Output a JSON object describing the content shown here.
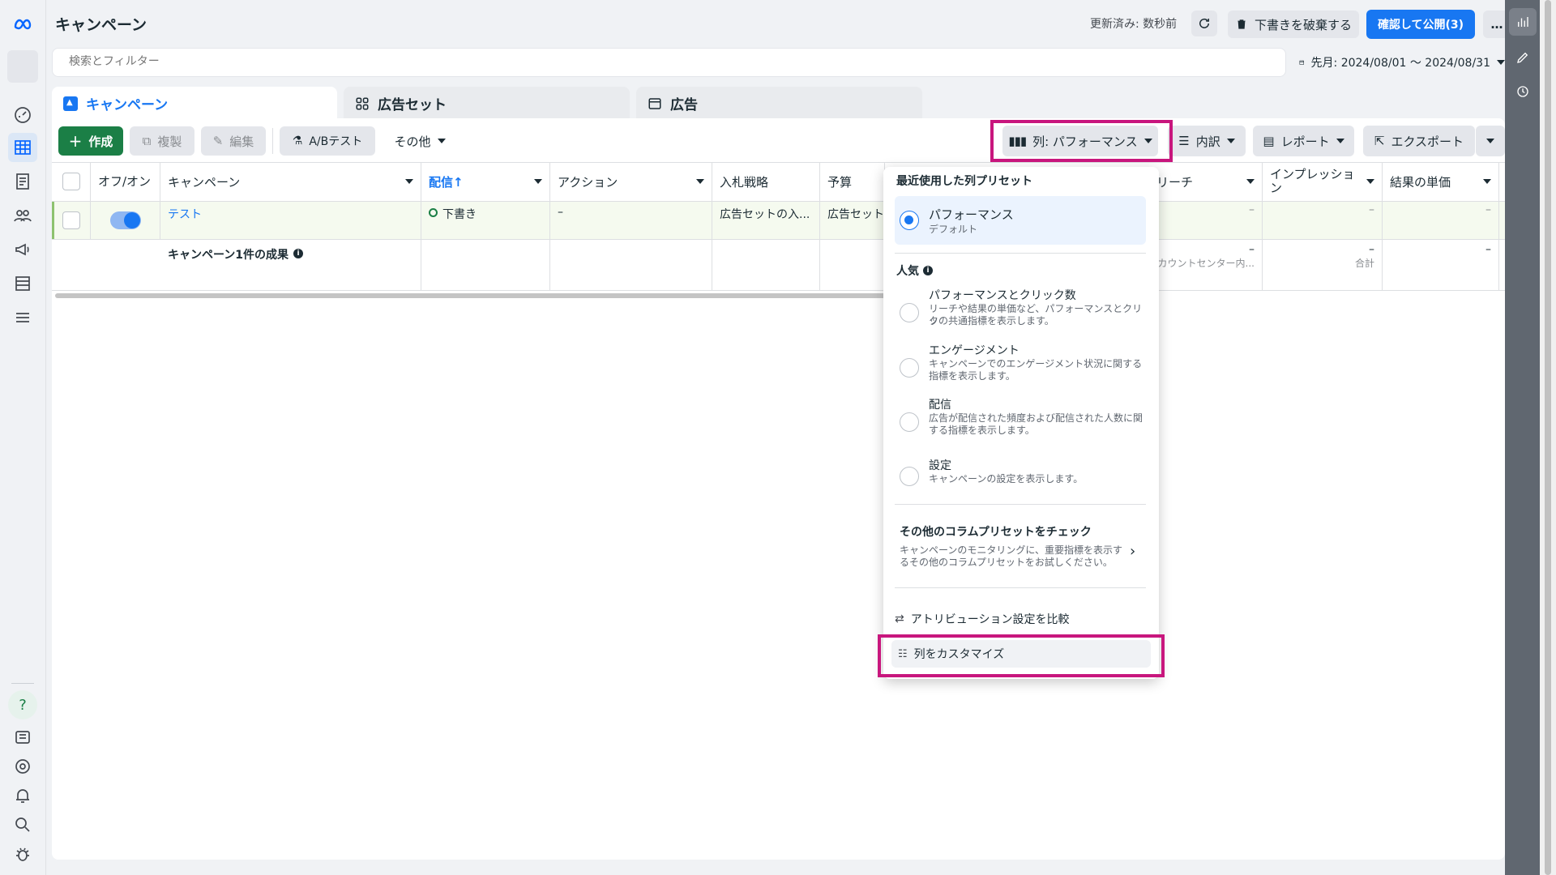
{
  "header": {
    "title": "キャンペーン",
    "updated": "更新済み: 数秒前",
    "discard_label": "下書きを破棄する",
    "publish_label": "確認して公開(3)",
    "more_label": "…"
  },
  "search": {
    "placeholder": "検索とフィルター"
  },
  "date_range": {
    "label": "先月: 2024/08/01 ～ 2024/08/31"
  },
  "tabs": [
    {
      "label": "キャンペーン",
      "active": true
    },
    {
      "label": "広告セット",
      "active": false
    },
    {
      "label": "広告",
      "active": false
    }
  ],
  "toolbar": {
    "create": "作成",
    "duplicate": "複製",
    "edit": "編集",
    "abtest": "A/Bテスト",
    "more": "その他",
    "columns": "列: パフォーマンス",
    "breakdown": "内訳",
    "reports": "レポート",
    "export": "エクスポート"
  },
  "table": {
    "columns": {
      "toggle": "オフ/オン",
      "campaign": "キャンペーン",
      "delivery": "配信↑",
      "actions": "アクション",
      "bid": "入札戦略",
      "budget": "予算",
      "reach": "リーチ",
      "impressions": "インプレッション",
      "cost_per_result": "結果の単価"
    },
    "row": {
      "name": "テスト",
      "delivery": "下書き",
      "actions": "–",
      "bid": "広告セットの入...",
      "budget": "広告セット",
      "reach": "–",
      "impressions": "–",
      "cost_per_result": "–"
    },
    "summary": {
      "label": "キャンペーン1件の成果",
      "reach": "–",
      "reach_sub": "アカウントセンター内...",
      "impressions": "–",
      "impressions_sub": "合計",
      "cost_per_result": "–"
    }
  },
  "dropdown": {
    "recent_title": "最近使用した列プリセット",
    "selected": {
      "title": "パフォーマンス",
      "sub": "デフォルト"
    },
    "popular_title": "人気",
    "options": [
      {
        "title": "パフォーマンスとクリック数",
        "desc1": "リーチや結果の単価など、パフォーマンスとクリッ",
        "desc2": "クの共通指標を表示します。"
      },
      {
        "title": "エンゲージメント",
        "desc1": "キャンペーンでのエンゲージメント状況に関する",
        "desc2": "指標を表示します。"
      },
      {
        "title": "配信",
        "desc1": "広告が配信された頻度および配信された人数に関",
        "desc2": "する指標を表示します。"
      },
      {
        "title": "設定",
        "desc1": "キャンペーンの設定を表示します。",
        "desc2": ""
      }
    ],
    "more_title": "その他のコラムプリセットをチェック",
    "more_desc1": "キャンペーンのモニタリングに、重要指標を表示す",
    "more_desc2": "るその他のコラムプリセットをお試しください。",
    "compare": "アトリビューション設定を比較",
    "customize": "列をカスタマイズ"
  },
  "colors": {
    "accent": "#1877f2",
    "create": "#1b7f46",
    "highlight": "#c8167d"
  }
}
